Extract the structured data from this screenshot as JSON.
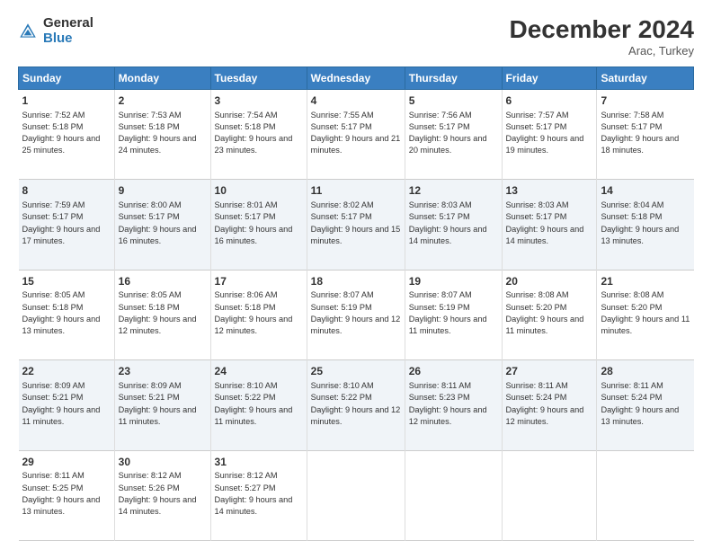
{
  "header": {
    "logo_general": "General",
    "logo_blue": "Blue",
    "month_title": "December 2024",
    "location": "Arac, Turkey"
  },
  "days_of_week": [
    "Sunday",
    "Monday",
    "Tuesday",
    "Wednesday",
    "Thursday",
    "Friday",
    "Saturday"
  ],
  "weeks": [
    [
      {
        "day": "1",
        "sunrise": "7:52 AM",
        "sunset": "5:18 PM",
        "daylight": "9 hours and 25 minutes."
      },
      {
        "day": "2",
        "sunrise": "7:53 AM",
        "sunset": "5:18 PM",
        "daylight": "9 hours and 24 minutes."
      },
      {
        "day": "3",
        "sunrise": "7:54 AM",
        "sunset": "5:18 PM",
        "daylight": "9 hours and 23 minutes."
      },
      {
        "day": "4",
        "sunrise": "7:55 AM",
        "sunset": "5:17 PM",
        "daylight": "9 hours and 21 minutes."
      },
      {
        "day": "5",
        "sunrise": "7:56 AM",
        "sunset": "5:17 PM",
        "daylight": "9 hours and 20 minutes."
      },
      {
        "day": "6",
        "sunrise": "7:57 AM",
        "sunset": "5:17 PM",
        "daylight": "9 hours and 19 minutes."
      },
      {
        "day": "7",
        "sunrise": "7:58 AM",
        "sunset": "5:17 PM",
        "daylight": "9 hours and 18 minutes."
      }
    ],
    [
      {
        "day": "8",
        "sunrise": "7:59 AM",
        "sunset": "5:17 PM",
        "daylight": "9 hours and 17 minutes."
      },
      {
        "day": "9",
        "sunrise": "8:00 AM",
        "sunset": "5:17 PM",
        "daylight": "9 hours and 16 minutes."
      },
      {
        "day": "10",
        "sunrise": "8:01 AM",
        "sunset": "5:17 PM",
        "daylight": "9 hours and 16 minutes."
      },
      {
        "day": "11",
        "sunrise": "8:02 AM",
        "sunset": "5:17 PM",
        "daylight": "9 hours and 15 minutes."
      },
      {
        "day": "12",
        "sunrise": "8:03 AM",
        "sunset": "5:17 PM",
        "daylight": "9 hours and 14 minutes."
      },
      {
        "day": "13",
        "sunrise": "8:03 AM",
        "sunset": "5:17 PM",
        "daylight": "9 hours and 14 minutes."
      },
      {
        "day": "14",
        "sunrise": "8:04 AM",
        "sunset": "5:18 PM",
        "daylight": "9 hours and 13 minutes."
      }
    ],
    [
      {
        "day": "15",
        "sunrise": "8:05 AM",
        "sunset": "5:18 PM",
        "daylight": "9 hours and 13 minutes."
      },
      {
        "day": "16",
        "sunrise": "8:05 AM",
        "sunset": "5:18 PM",
        "daylight": "9 hours and 12 minutes."
      },
      {
        "day": "17",
        "sunrise": "8:06 AM",
        "sunset": "5:18 PM",
        "daylight": "9 hours and 12 minutes."
      },
      {
        "day": "18",
        "sunrise": "8:07 AM",
        "sunset": "5:19 PM",
        "daylight": "9 hours and 12 minutes."
      },
      {
        "day": "19",
        "sunrise": "8:07 AM",
        "sunset": "5:19 PM",
        "daylight": "9 hours and 11 minutes."
      },
      {
        "day": "20",
        "sunrise": "8:08 AM",
        "sunset": "5:20 PM",
        "daylight": "9 hours and 11 minutes."
      },
      {
        "day": "21",
        "sunrise": "8:08 AM",
        "sunset": "5:20 PM",
        "daylight": "9 hours and 11 minutes."
      }
    ],
    [
      {
        "day": "22",
        "sunrise": "8:09 AM",
        "sunset": "5:21 PM",
        "daylight": "9 hours and 11 minutes."
      },
      {
        "day": "23",
        "sunrise": "8:09 AM",
        "sunset": "5:21 PM",
        "daylight": "9 hours and 11 minutes."
      },
      {
        "day": "24",
        "sunrise": "8:10 AM",
        "sunset": "5:22 PM",
        "daylight": "9 hours and 11 minutes."
      },
      {
        "day": "25",
        "sunrise": "8:10 AM",
        "sunset": "5:22 PM",
        "daylight": "9 hours and 12 minutes."
      },
      {
        "day": "26",
        "sunrise": "8:11 AM",
        "sunset": "5:23 PM",
        "daylight": "9 hours and 12 minutes."
      },
      {
        "day": "27",
        "sunrise": "8:11 AM",
        "sunset": "5:24 PM",
        "daylight": "9 hours and 12 minutes."
      },
      {
        "day": "28",
        "sunrise": "8:11 AM",
        "sunset": "5:24 PM",
        "daylight": "9 hours and 13 minutes."
      }
    ],
    [
      {
        "day": "29",
        "sunrise": "8:11 AM",
        "sunset": "5:25 PM",
        "daylight": "9 hours and 13 minutes."
      },
      {
        "day": "30",
        "sunrise": "8:12 AM",
        "sunset": "5:26 PM",
        "daylight": "9 hours and 14 minutes."
      },
      {
        "day": "31",
        "sunrise": "8:12 AM",
        "sunset": "5:27 PM",
        "daylight": "9 hours and 14 minutes."
      },
      null,
      null,
      null,
      null
    ]
  ],
  "labels": {
    "sunrise": "Sunrise:",
    "sunset": "Sunset:",
    "daylight": "Daylight:"
  }
}
